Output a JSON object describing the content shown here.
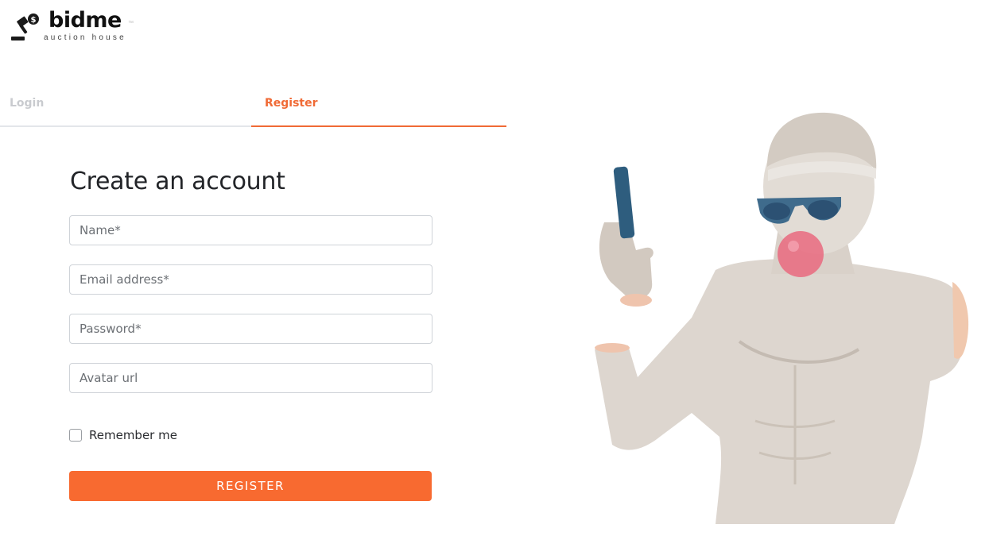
{
  "brand": {
    "name": "bidme",
    "tagline": "auction house",
    "tm": "™"
  },
  "tabs": [
    {
      "label": "Login",
      "active": false
    },
    {
      "label": "Register",
      "active": true
    }
  ],
  "form": {
    "title": "Create an account",
    "fields": {
      "name": {
        "placeholder": "Name*",
        "value": ""
      },
      "email": {
        "placeholder": "Email address*",
        "value": ""
      },
      "password": {
        "placeholder": "Password*",
        "value": ""
      },
      "avatar": {
        "placeholder": "Avatar url",
        "value": ""
      }
    },
    "remember_label": "Remember me",
    "remember_checked": false,
    "submit_label": "REGISTER"
  },
  "colors": {
    "accent": "#f86a30",
    "tab_active": "#f06a35",
    "tab_inactive": "#c9cbcf",
    "border": "#cfd3d8"
  },
  "illustration": {
    "icon": "statue-with-phone-and-sunglasses-illustration"
  }
}
